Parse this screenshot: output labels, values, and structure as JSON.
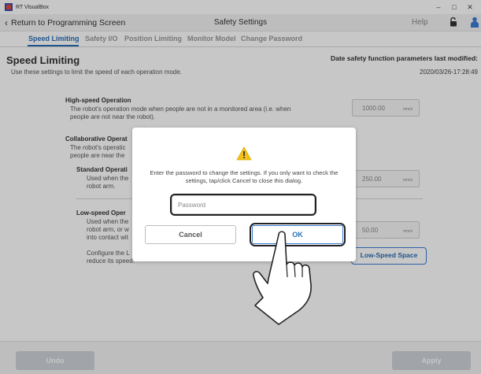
{
  "window": {
    "app_title": "RT VisualBox",
    "minimize": "–",
    "maximize": "□",
    "close": "✕"
  },
  "header": {
    "back_label": "Return to Programming Screen",
    "title": "Safety Settings",
    "help_label": "Help"
  },
  "tabs": [
    {
      "label": "Speed Limiting",
      "active": true
    },
    {
      "label": "Safety I/O"
    },
    {
      "label": "Position Limiting"
    },
    {
      "label": "Monitor Model"
    },
    {
      "label": "Change Password"
    }
  ],
  "page": {
    "title": "Speed Limiting",
    "description": "Use these settings to limit the speed of each operation mode.",
    "modified_label": "Date safety function parameters last modified:",
    "modified_value": "2020/03/26-17:28:49"
  },
  "sections": {
    "high_speed": {
      "title": "High-speed Operation",
      "desc1": "The robot's operation mode when people are not in a monitored area (i.e. when",
      "desc2": "people are not near the robot).",
      "value": "1000.00",
      "unit": "mm/s"
    },
    "collaborative": {
      "title": "Collaborative Operat",
      "desc1": "The robot's operatic",
      "desc2": "people are near the"
    },
    "standard": {
      "title": "Standard Operati",
      "desc1": "Used when the",
      "desc2": "robot arm.",
      "value": "250.00",
      "unit": "mm/s"
    },
    "low_speed": {
      "title": "Low-speed Oper",
      "desc1": "Used when the",
      "desc2": "robot arm, or w",
      "desc3": "into contact wit",
      "value": "50.00",
      "unit": "mm/s"
    },
    "configure": {
      "desc1": "Configure the L",
      "desc2": "reduce its speed."
    },
    "low_speed_space_button": "Low-Speed Space"
  },
  "dialog": {
    "message": "Enter the password to change the settings. If you only want to check the settings, tap/click Cancel to close this dialog.",
    "password_placeholder": "Password",
    "cancel_label": "Cancel",
    "ok_label": "OK"
  },
  "footer": {
    "undo_label": "Undo",
    "apply_label": "Apply"
  },
  "colors": {
    "accent": "#2a6fb5",
    "warning": "#f2c21b"
  }
}
